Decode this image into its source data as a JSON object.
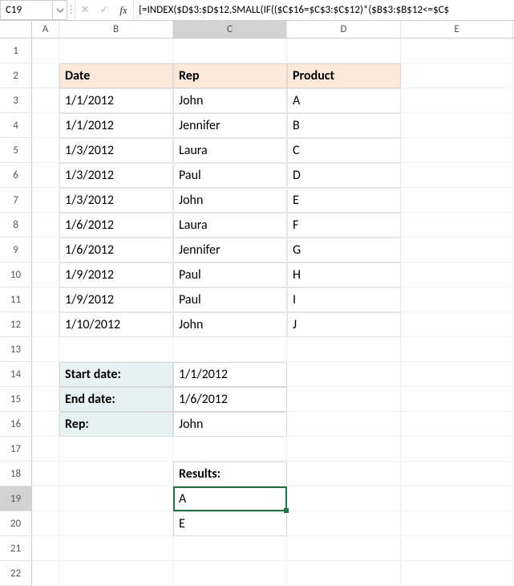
{
  "formula_bar": {
    "active_cell": "C19",
    "cancel": "✕",
    "confirm": "✓",
    "fx": "fx",
    "formula": "{=INDEX($D$3:$D$12,SMALL(IF(($C$16=$C$3:$C$12)*($B$3:$B$12<=$C$"
  },
  "columns": [
    "A",
    "B",
    "C",
    "D",
    "E"
  ],
  "rows": [
    "1",
    "2",
    "3",
    "4",
    "5",
    "6",
    "7",
    "8",
    "9",
    "10",
    "11",
    "12",
    "13",
    "14",
    "15",
    "16",
    "17",
    "18",
    "19",
    "20",
    "21",
    "22"
  ],
  "table": {
    "headers": {
      "date": "Date",
      "rep": "Rep",
      "product": "Product"
    },
    "rows": [
      {
        "date": "1/1/2012",
        "rep": "John",
        "product": "A"
      },
      {
        "date": "1/1/2012",
        "rep": "Jennifer",
        "product": "B"
      },
      {
        "date": "1/3/2012",
        "rep": "Laura",
        "product": "C"
      },
      {
        "date": "1/3/2012",
        "rep": "Paul",
        "product": "D"
      },
      {
        "date": "1/3/2012",
        "rep": "John",
        "product": "E"
      },
      {
        "date": "1/6/2012",
        "rep": "Laura",
        "product": "F"
      },
      {
        "date": "1/6/2012",
        "rep": "Jennifer",
        "product": "G"
      },
      {
        "date": "1/9/2012",
        "rep": "Paul",
        "product": "H"
      },
      {
        "date": "1/9/2012",
        "rep": "Paul",
        "product": "I"
      },
      {
        "date": "1/10/2012",
        "rep": "John",
        "product": "J"
      }
    ]
  },
  "criteria": {
    "start_label": "Start date:",
    "start_val": "1/1/2012",
    "end_label": "End date:",
    "end_val": "1/6/2012",
    "rep_label": "Rep:",
    "rep_val": "John"
  },
  "results": {
    "header": "Results:",
    "values": [
      "A",
      "E"
    ]
  }
}
